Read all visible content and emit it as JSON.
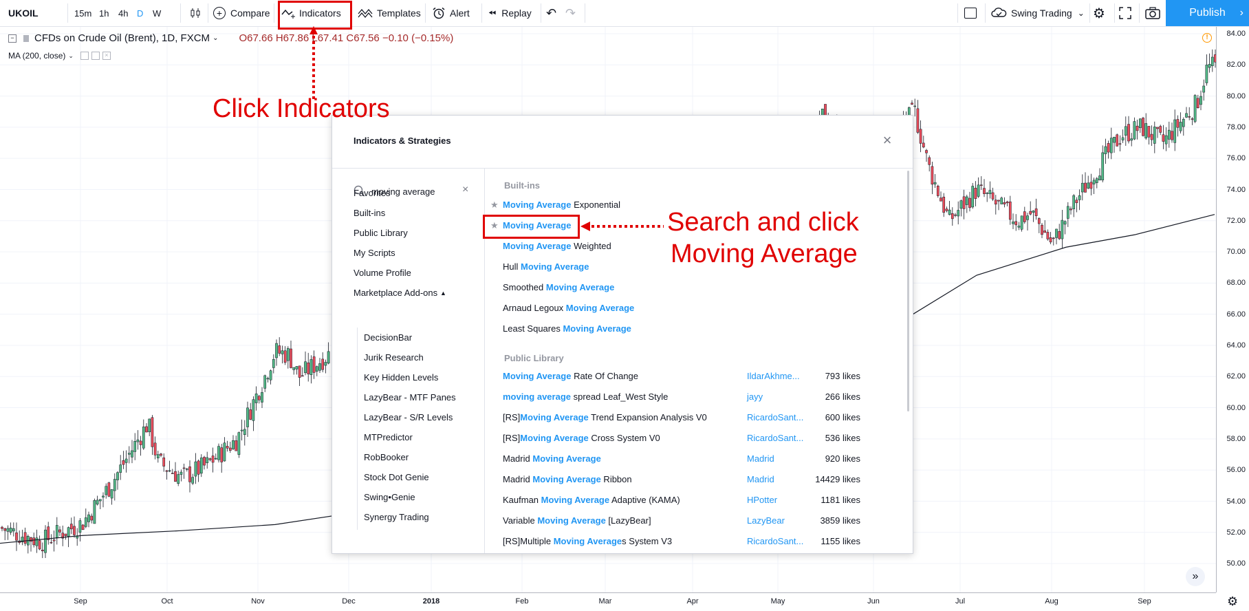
{
  "toolbar": {
    "symbol": "UKOIL",
    "intervals": [
      "15m",
      "1h",
      "4h",
      "D",
      "W"
    ],
    "active_interval": "D",
    "compare_label": "Compare",
    "indicators_label": "Indicators",
    "templates_label": "Templates",
    "alert_label": "Alert",
    "replay_label": "Replay",
    "layout_name": "Swing Trading",
    "publish_label": "Publish"
  },
  "legend": {
    "title": "CFDs on Crude Oil (Brent), 1D, FXCM",
    "ohlc": "O67.66  H67.86  L67.41  C67.56  −0.10 (−0.15%)",
    "ma": "MA (200, close)"
  },
  "price_axis": [
    "84.00",
    "82.00",
    "80.00",
    "78.00",
    "76.00",
    "74.00",
    "72.00",
    "70.00",
    "68.00",
    "66.00",
    "64.00",
    "62.00",
    "60.00",
    "58.00",
    "56.00",
    "54.00",
    "52.00",
    "50.00"
  ],
  "time_axis": [
    "Sep",
    "Oct",
    "Nov",
    "Dec",
    "2018",
    "Feb",
    "Mar",
    "Apr",
    "May",
    "Jun",
    "Jul",
    "Aug",
    "Sep"
  ],
  "dialog": {
    "title": "Indicators & Strategies",
    "search_value": "moving average",
    "categories": [
      "Favorites",
      "Built-ins",
      "Public Library",
      "My Scripts",
      "Volume Profile",
      "Marketplace Add-ons"
    ],
    "marketplace": [
      "DecisionBar",
      "Jurik Research",
      "Key Hidden Levels",
      "LazyBear - MTF Panes",
      "LazyBear - S/R Levels",
      "MTPredictor",
      "RobBooker",
      "Stock Dot Genie",
      "Swing•Genie",
      "Synergy Trading"
    ],
    "builtins_title": "Built-ins",
    "builtins": [
      {
        "pre": "",
        "hl": "Moving Average",
        "post": " Exponential",
        "fav": true
      },
      {
        "pre": "",
        "hl": "Moving Average",
        "post": "",
        "fav": true
      },
      {
        "pre": "",
        "hl": "Moving Average",
        "post": " Weighted",
        "fav": false
      },
      {
        "pre": "Hull ",
        "hl": "Moving Average",
        "post": "",
        "fav": false
      },
      {
        "pre": "Smoothed ",
        "hl": "Moving Average",
        "post": "",
        "fav": false
      },
      {
        "pre": "Arnaud Legoux ",
        "hl": "Moving Average",
        "post": "",
        "fav": false
      },
      {
        "pre": "Least Squares ",
        "hl": "Moving Average",
        "post": "",
        "fav": false
      }
    ],
    "public_title": "Public Library",
    "public": [
      {
        "pre": "",
        "hl": "Moving Average",
        "post": " Rate Of Change",
        "author": "IldarAkhme...",
        "likes": "793 likes"
      },
      {
        "pre": "",
        "hl": "moving average",
        "post": " spread Leaf_West Style",
        "author": "jayy",
        "likes": "266 likes"
      },
      {
        "pre": "[RS]",
        "hl": "Moving Average",
        "post": " Trend Expansion Analysis V0",
        "author": "RicardoSant...",
        "likes": "600 likes"
      },
      {
        "pre": "[RS]",
        "hl": "Moving Average",
        "post": " Cross System V0",
        "author": "RicardoSant...",
        "likes": "536 likes"
      },
      {
        "pre": "Madrid ",
        "hl": "Moving Average",
        "post": "",
        "author": "Madrid",
        "likes": "920 likes"
      },
      {
        "pre": "Madrid ",
        "hl": "Moving Average",
        "post": " Ribbon",
        "author": "Madrid",
        "likes": "14429 likes"
      },
      {
        "pre": "Kaufman ",
        "hl": "Moving Average",
        "post": " Adaptive (KAMA)",
        "author": "HPotter",
        "likes": "1181 likes"
      },
      {
        "pre": "Variable ",
        "hl": "Moving Average",
        "post": " [LazyBear]",
        "author": "LazyBear",
        "likes": "3859 likes"
      },
      {
        "pre": "[RS]Multiple ",
        "hl": "Moving Average",
        "post": "s System V3",
        "author": "RicardoSant...",
        "likes": "1155 likes"
      }
    ]
  },
  "annotations": {
    "click_indicators": "Click Indicators",
    "search_line1": "Search and click",
    "search_line2": "Moving Average"
  },
  "colors": {
    "accent": "#2196f3",
    "up": "#53b987",
    "down": "#eb4d5c",
    "annotation": "#e00000"
  }
}
